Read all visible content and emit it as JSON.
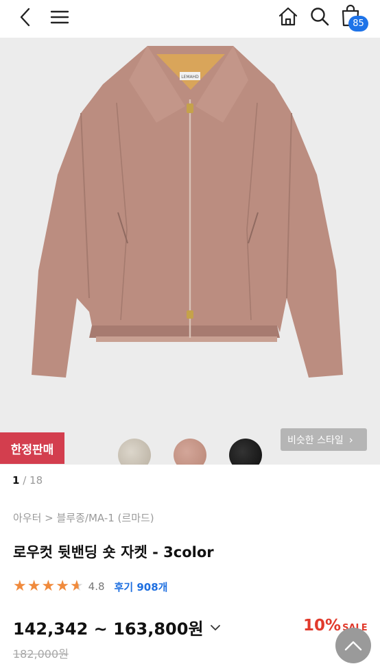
{
  "header": {
    "icons": [
      "back-icon",
      "menu-icon",
      "home-icon",
      "search-icon",
      "shopping-bag-icon"
    ],
    "cart_count": "85"
  },
  "gallery": {
    "swatches": [
      {
        "name": "beige",
        "color": "#c9c1b3"
      },
      {
        "name": "pink",
        "color": "#c4958a"
      },
      {
        "name": "black",
        "color": "#151515"
      }
    ],
    "limited_label": "한정판매",
    "similar_label": "비슷한 스타일",
    "page_current": "1",
    "page_total": "/ 18",
    "jacket_color": "#b98c80",
    "tag_text": "LEMAHD"
  },
  "product": {
    "breadcrumb": "아우터 > 블루종/MA-1 (르마드)",
    "title": "로우컷 뒷밴딩 숏 자켓 - 3color",
    "rating_value": 4.7,
    "rating_text": "4.8",
    "review_text": "후기 908개",
    "price_range": "142,342 ~ 163,800원",
    "original_price": "182,000원",
    "discount": "10%",
    "sale_label": "SALE"
  },
  "colors": {
    "accent_blue": "#1e73e8",
    "limited_red": "#d33e4e",
    "star_orange": "#f08a3c",
    "discount_red": "#e13a2c"
  }
}
